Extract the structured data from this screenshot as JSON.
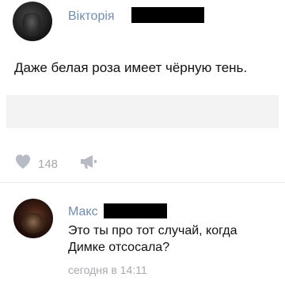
{
  "post": {
    "author": "Вікторія",
    "text": "Даже белая роза имеет чёрную тень.",
    "likes": "148"
  },
  "comment": {
    "author": "Макс",
    "line1": "Это ты про тот случай, когда",
    "line2": "Димке отсосала?",
    "time": "сегодня в 14:11"
  },
  "colors": {
    "author_link": "#6f8eb3",
    "meta_gray": "#a6a9ae"
  },
  "icons": {
    "like": "heart-icon",
    "share": "megaphone-icon"
  }
}
